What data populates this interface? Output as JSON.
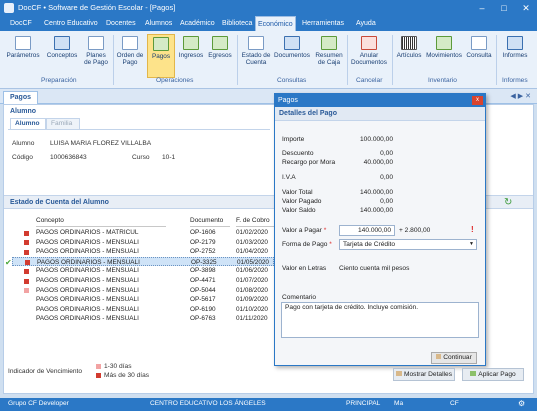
{
  "window": {
    "title": "DocCF • Software de Gestión Escolar - [Pagos]"
  },
  "menu": [
    "DocCF",
    "Centro Educativo",
    "Docentes",
    "Alumnos",
    "Académico",
    "Biblioteca",
    "Económico",
    "Herramientas",
    "Ayuda"
  ],
  "ribbon": {
    "buttons": [
      "Parámetros",
      "Conceptos",
      "Planes de Pago",
      "Orden de Pago",
      "Pagos",
      "Ingresos",
      "Egresos",
      "Estado de Cuenta",
      "Documentos",
      "Resumen de Caja",
      "Anular Documentos",
      "Artículos",
      "Movimientos",
      "Consulta",
      "Informes"
    ],
    "groups": [
      "Preparación",
      "Operaciones",
      "Consultas",
      "Cancelar",
      "Inventario",
      "Informes"
    ]
  },
  "tab": {
    "label": "Pagos"
  },
  "alumno": {
    "section": "Alumno",
    "tabs": [
      "Alumno",
      "Familia"
    ],
    "name_label": "Alumno",
    "name": "LUISA MARIA  FLOREZ VILLALBA",
    "code_label": "Código",
    "code": "1000636843",
    "course_label": "Curso",
    "course": "10-1"
  },
  "estado": {
    "title": "Estado de Cuenta del Alumno"
  },
  "table": {
    "headers": [
      "Concepto",
      "Documento",
      "F. de Cobro"
    ],
    "rows": [
      {
        "concepto": "PAGOS ORDINARIOS - MATRICUL",
        "documento": "OP-1606",
        "fecha": "01/02/2020",
        "flag": "red"
      },
      {
        "concepto": "PAGOS ORDINARIOS - MENSUALI",
        "documento": "OP-2179",
        "fecha": "01/03/2020",
        "flag": "red"
      },
      {
        "concepto": "PAGOS ORDINARIOS - MENSUALI",
        "documento": "OP-2752",
        "fecha": "01/04/2020",
        "flag": "red"
      },
      {
        "concepto": "PAGOS ORDINARIOS - MENSUALI",
        "documento": "OP-3325",
        "fecha": "01/05/2020",
        "flag": "red"
      },
      {
        "concepto": "PAGOS ORDINARIOS - MENSUALI",
        "documento": "OP-3898",
        "fecha": "01/06/2020",
        "flag": "red"
      },
      {
        "concepto": "PAGOS ORDINARIOS - MENSUALI",
        "documento": "OP-4471",
        "fecha": "01/07/2020",
        "flag": "red"
      },
      {
        "concepto": "PAGOS ORDINARIOS - MENSUALI",
        "documento": "OP-5044",
        "fecha": "01/08/2020",
        "flag": "pink"
      },
      {
        "concepto": "PAGOS ORDINARIOS - MENSUALI",
        "documento": "OP-5617",
        "fecha": "01/09/2020",
        "flag": ""
      },
      {
        "concepto": "PAGOS ORDINARIOS - MENSUALI",
        "documento": "OP-6190",
        "fecha": "01/10/2020",
        "flag": ""
      },
      {
        "concepto": "PAGOS ORDINARIOS - MENSUALI",
        "documento": "OP-6763",
        "fecha": "01/11/2020",
        "flag": ""
      }
    ]
  },
  "legend": {
    "label": "Indicador de Vencimiento",
    "items": [
      "1-30 días",
      "Más de 30 días"
    ]
  },
  "modal": {
    "title": "Pagos",
    "close": "x",
    "subtitle": "Detalles del Pago",
    "importe_label": "Importe",
    "importe": "100.000,00",
    "descuento_label": "Descuento",
    "descuento": "0,00",
    "recargo_label": "Recargo por Mora",
    "recargo": "40.000,00",
    "iva_label": "I.V.A",
    "iva": "0,00",
    "total_label": "Valor Total",
    "total": "140.000,00",
    "pagado_label": "Valor Pagado",
    "pagado": "0,00",
    "saldo_label": "Valor Saldo",
    "saldo": "140.000,00",
    "pagar_label": "Valor a Pagar",
    "pagar": "140.000,00",
    "extra": "+ 2.800,00",
    "forma_label": "Forma de Pago",
    "forma": "Tarjeta de Crédito",
    "letras_label": "Valor en Letras",
    "letras": "Ciento cuenta mil pesos",
    "comentario_label": "Comentario",
    "comentario": "Pago con tarjeta de crédito. Incluye comisión.",
    "continuar": "Continuar"
  },
  "actions": {
    "mostrar": "Mostrar Detalles",
    "aplicar": "Aplicar Pago"
  },
  "status": {
    "user": "Grupo CF Developer",
    "school": "CENTRO EDUCATIVO LOS ÁNGELES",
    "branch": "PRINCIPAL",
    "role": "Ma",
    "app": "CF"
  }
}
